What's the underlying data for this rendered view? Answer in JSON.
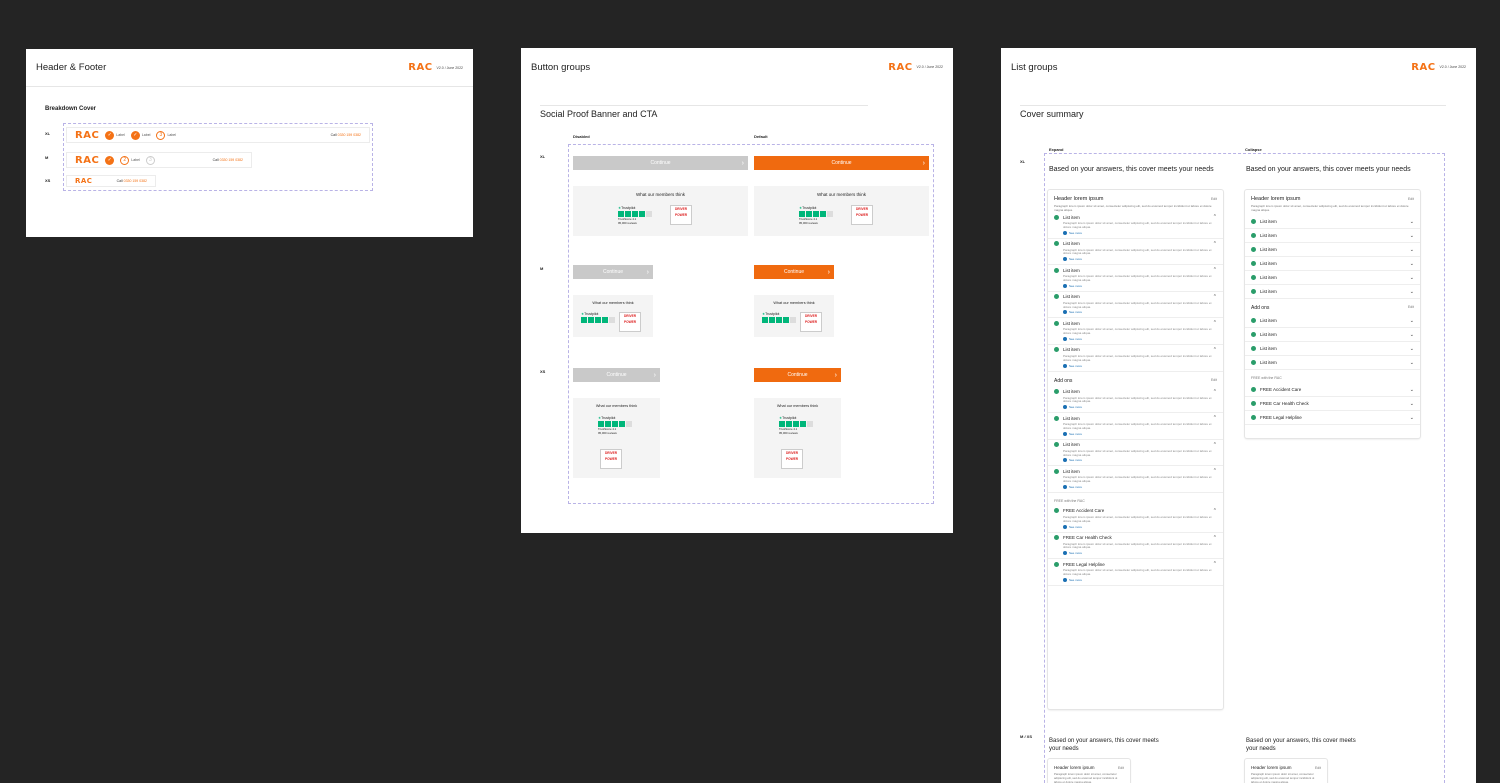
{
  "boards": {
    "header_footer": {
      "title": "Header & Footer",
      "logo": "RAC",
      "version": "V2.0 / June 2022",
      "section": "Breakdown Cover",
      "sizes": [
        "XL",
        "M",
        "XS"
      ],
      "step_label": "Label",
      "call_prefix": "Call",
      "call_number": "0330 159 0382"
    },
    "button_groups": {
      "title": "Button groups",
      "logo": "RAC",
      "version": "V2.0 / June 2022",
      "section": "Social Proof Banner and CTA",
      "col_disabled": "Disabled",
      "col_default": "Default",
      "sizes": [
        "XL",
        "M",
        "XS"
      ],
      "button_label": "Continue",
      "proof_title": "What our members think",
      "trustpilot": "Trustpilot",
      "trustscore": "TrustScore 4.1",
      "reviews": "95,000 reviews",
      "driver_power_1": "DRIVER",
      "driver_power_2": "POWER"
    },
    "list_groups": {
      "title": "List groups",
      "logo": "RAC",
      "version": "V2.0 / June 2022",
      "section": "Cover summary",
      "col_expand": "Expand",
      "col_collapse": "Collapse",
      "size_xl": "XL",
      "size_mxs": "M / XS",
      "heading": "Based on your answers, this cover meets your needs",
      "card_header": "Header lorem ipsum",
      "edit": "Edit",
      "para": "Paragraph lorem ipsum dolor sit amet, consectetur adipiscing elit, sed do eiusmod tempor incididunt ut labore et dolore magna aliqua.",
      "list_item": "List item",
      "see_more": "See more",
      "addons": "Add ons",
      "free_title": "FREE with the RAC",
      "free_items": [
        "FREE Accident Care",
        "FREE Car Health Check",
        "FREE Legal Helpline"
      ]
    }
  }
}
